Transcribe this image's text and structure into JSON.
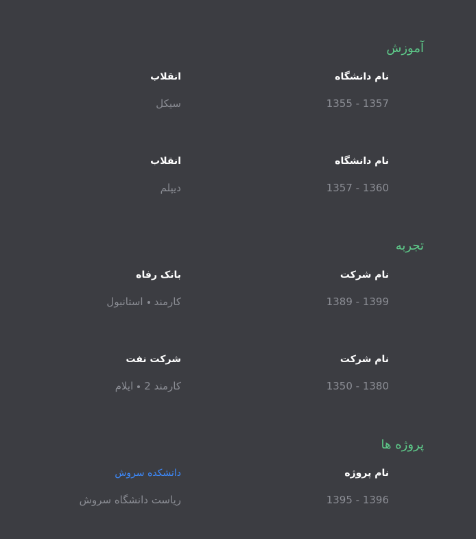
{
  "education": {
    "title": "آموزش",
    "items": [
      {
        "label": "نام دانشگاه",
        "value": "انقلاب",
        "period": "1355 - 1357",
        "detail": "سیکل"
      },
      {
        "label": "نام دانشگاه",
        "value": "انقلاب",
        "period": "1357 - 1360",
        "detail": "دیپلم"
      }
    ]
  },
  "experience": {
    "title": "تجربه",
    "items": [
      {
        "label": "نام شرکت",
        "value": "بانک رفاه",
        "period": "1389 - 1399",
        "role": "کارمند",
        "location": "استانبول"
      },
      {
        "label": "نام شرکت",
        "value": "شرکت نفت",
        "period": "1350 - 1380",
        "role": "کارمند 2",
        "location": "ایلام"
      }
    ]
  },
  "projects": {
    "title": "پروژه ها",
    "items": [
      {
        "label": "نام پروژه",
        "value": "دانشکده سروش",
        "period": "1395 - 1396",
        "detail": "ریاست دانشگاه سروش"
      }
    ]
  },
  "colors": {
    "background": "#3c3d42",
    "accent": "#5ecb8a",
    "link": "#3d8bff",
    "muted": "#8b8d94"
  }
}
